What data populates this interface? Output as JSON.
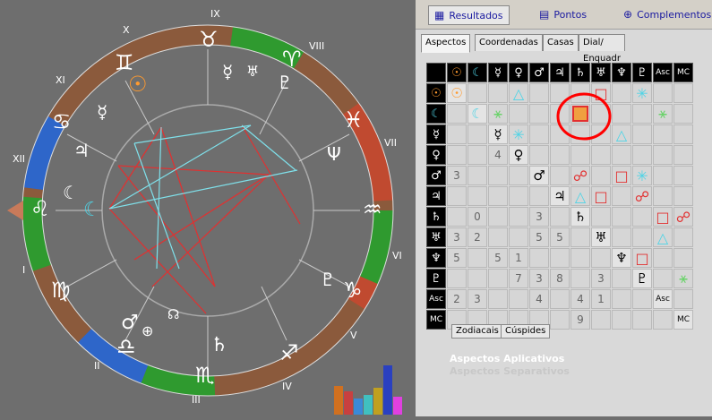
{
  "toolbar": {
    "resultados": "Resultados",
    "pontos": "Pontos",
    "complementos": "Complementos"
  },
  "subtabs": [
    "Aspectos",
    "Coordenadas",
    "Casas",
    "Dial/ Enquadr"
  ],
  "grid_headers": [
    "☉",
    "☾",
    "☿",
    "♀",
    "♂",
    "♃",
    "♄",
    "♅",
    "♆",
    "♇",
    "Asc",
    "MC"
  ],
  "grid_cells": [
    [
      "",
      "",
      "",
      "△",
      "",
      "",
      "",
      "□",
      "",
      "✳",
      "",
      ""
    ],
    [
      "",
      "",
      "⚹",
      "",
      "",
      "",
      "",
      "",
      "",
      "",
      "⚹",
      ""
    ],
    [
      "",
      "",
      "",
      "✳",
      "",
      "",
      "",
      "",
      "△",
      "",
      "",
      ""
    ],
    [
      "",
      "",
      "4",
      "",
      "",
      "",
      "",
      "",
      "",
      "",
      "",
      ""
    ],
    [
      "3",
      "",
      "",
      "",
      "",
      "",
      "☍",
      "",
      "□",
      "✳",
      "",
      ""
    ],
    [
      "",
      "",
      "",
      "",
      "",
      "",
      "△",
      "□",
      "",
      "☍",
      "",
      ""
    ],
    [
      "",
      "0",
      "",
      "",
      "3",
      "",
      "",
      "",
      "",
      "",
      "□",
      "☍"
    ],
    [
      "3",
      "2",
      "",
      "",
      "5",
      "5",
      "",
      "",
      "",
      "",
      "△",
      ""
    ],
    [
      "5",
      "",
      "5",
      "1",
      "",
      "",
      "",
      "",
      "",
      "□",
      "",
      ""
    ],
    [
      "",
      "",
      "",
      "7",
      "3",
      "8",
      "",
      "3",
      "",
      "",
      "",
      "⚹"
    ],
    [
      "2",
      "3",
      "",
      "",
      "4",
      "",
      "4",
      "1",
      "",
      "",
      "",
      ""
    ],
    [
      "",
      "",
      "",
      "",
      "",
      "",
      "9",
      "",
      "",
      "",
      "",
      ""
    ]
  ],
  "bottom_tabs": [
    "Zodiacais",
    "Cúspides"
  ],
  "legend": {
    "aplicativos": "Aspectos Aplicativos",
    "separativos": "Aspectos Separativos"
  },
  "houses": [
    "IX",
    "X",
    "XI",
    "XII",
    "I",
    "II",
    "III",
    "IV",
    "V",
    "VI",
    "VII",
    "VIII"
  ],
  "signs": [
    "♉",
    "♈",
    "♓",
    "♒",
    "♑",
    "♐",
    "♏",
    "♎",
    "♍",
    "♌",
    "♋",
    "♊"
  ],
  "planets_on_chart": [
    "☿",
    "♅",
    "♇",
    "Ψ",
    "♇",
    "♄",
    "☊",
    "♂",
    "⊕",
    "♍",
    "☾",
    "☾",
    "♃",
    "☉",
    "☿"
  ],
  "colors": {
    "accent": "#1a1aa0",
    "highlight": "#ff0000",
    "cyan": "#4fd4e6",
    "red": "#e23030",
    "green": "#6bd36b"
  }
}
